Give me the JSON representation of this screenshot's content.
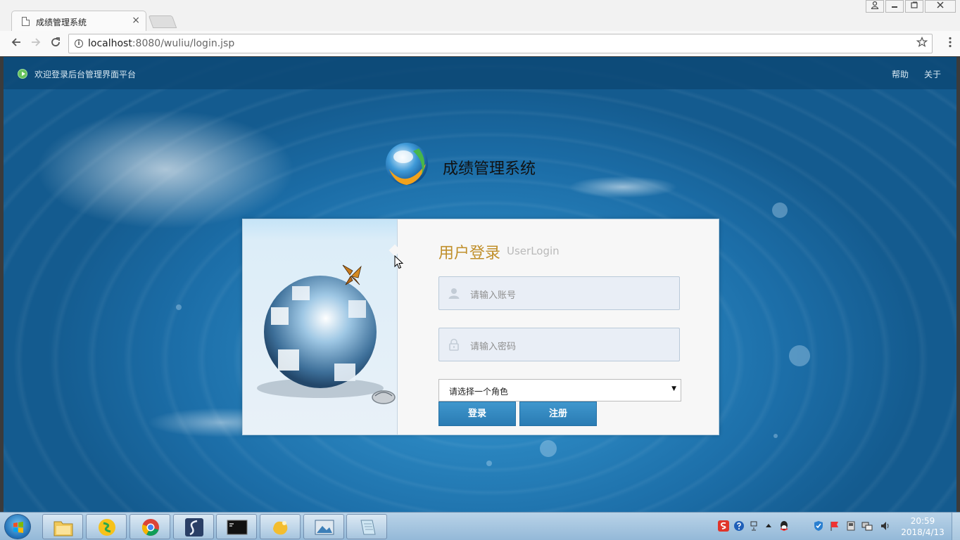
{
  "browser": {
    "tab_title": "成绩管理系统",
    "tab_close": "×",
    "url_host": "localhost",
    "url_rest": ":8080/wuliu/login.jsp"
  },
  "header": {
    "welcome_text": "欢迎登录后台管理界面平台",
    "nav": [
      "帮助",
      "关于"
    ]
  },
  "brand": {
    "title": "成绩管理系统"
  },
  "login": {
    "title_cn": "用户登录",
    "title_en": "UserLogin",
    "username_placeholder": "请输入账号",
    "password_placeholder": "请输入密码",
    "role_selected": "请选择一个角色",
    "login_button": "登录",
    "register_button": "注册"
  },
  "taskbar": {
    "time": "20:59",
    "date": "2018/4/13"
  },
  "colors": {
    "accent_button": "#2f85c0",
    "title_gold": "#c08f2a",
    "page_blue": "#2a85bf"
  },
  "icons": [
    "document-icon",
    "back-icon",
    "forward-icon",
    "reload-icon",
    "info-icon",
    "star-icon",
    "menu-icon",
    "play-icon",
    "user-icon",
    "lock-icon"
  ]
}
